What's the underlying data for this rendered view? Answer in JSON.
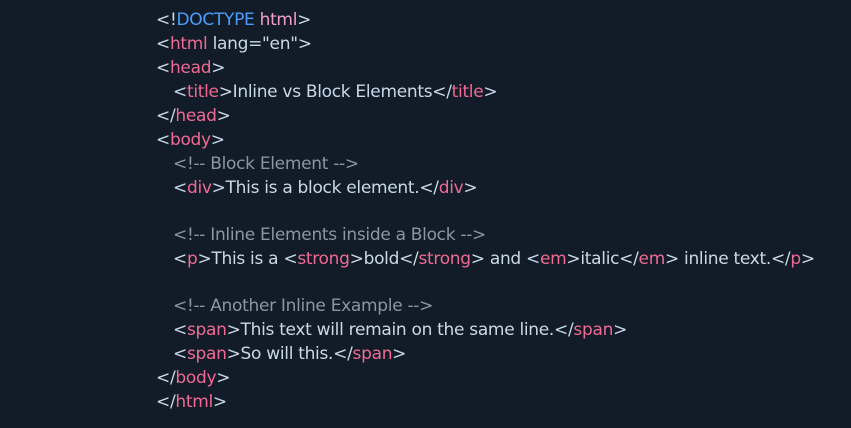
{
  "colors": {
    "background": "#111c28",
    "tag": "#f06a93",
    "doctype_keyword": "#4a9eff",
    "punctuation": "#c9d9e8",
    "comment": "#8a96a3"
  },
  "code": {
    "l1": {
      "open": "<!",
      "keyword": "DOCTYPE",
      "name": "html",
      "close": ">"
    },
    "l2": {
      "open": "<",
      "tag": "html",
      "attr": " lang=\"en\"",
      "close": ">"
    },
    "l3": {
      "open": "<",
      "tag": "head",
      "close": ">"
    },
    "l4": {
      "open1": "<",
      "tag1": "title",
      "close1": ">",
      "text": "Inline vs Block Elements",
      "open2": "</",
      "tag2": "title",
      "close2": ">"
    },
    "l5": {
      "open": "</",
      "tag": "head",
      "close": ">"
    },
    "l6": {
      "open": "<",
      "tag": "body",
      "close": ">"
    },
    "l7": {
      "comment": "<!-- Block Element -->"
    },
    "l8": {
      "open1": "<",
      "tag1": "div",
      "close1": ">",
      "text": "This is a block element.",
      "open2": "</",
      "tag2": "div",
      "close2": ">"
    },
    "l9": {
      "comment": "<!-- Inline Elements inside a Block -->"
    },
    "l10": {
      "p_open": "<",
      "p_tag": "p",
      "p_close": ">",
      "text1": "This is a ",
      "strong_open": "<",
      "strong_tag": "strong",
      "strong_close": ">",
      "bold": "bold",
      "strong_end_open": "</",
      "strong_end_tag": "strong",
      "strong_end_close": ">",
      "text2": " and ",
      "em_open": "<",
      "em_tag": "em",
      "em_close": ">",
      "italic": "italic",
      "em_end_open": "</",
      "em_end_tag": "em",
      "em_end_close": ">",
      "text3": " inline text.",
      "p_end_open": "</",
      "p_end_tag": "p",
      "p_end_close": ">"
    },
    "l11": {
      "comment": "<!-- Another Inline Example -->"
    },
    "l12": {
      "open1": "<",
      "tag1": "span",
      "close1": ">",
      "text": "This text will remain on the same line.",
      "open2": "</",
      "tag2": "span",
      "close2": ">"
    },
    "l13": {
      "open1": "<",
      "tag1": "span",
      "close1": ">",
      "text": "So will this.",
      "open2": "</",
      "tag2": "span",
      "close2": ">"
    },
    "l14": {
      "open": "</",
      "tag": "body",
      "close": ">"
    },
    "l15": {
      "open": "</",
      "tag": "html",
      "close": ">"
    }
  }
}
